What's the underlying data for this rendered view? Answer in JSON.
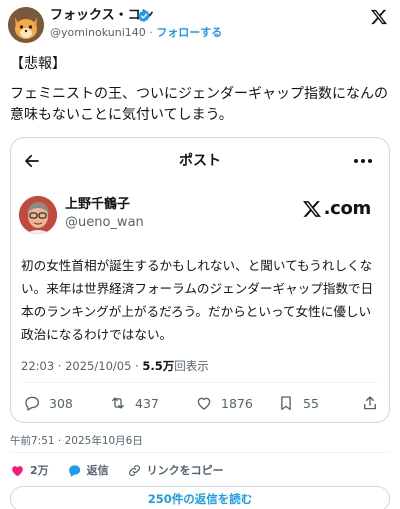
{
  "author": {
    "name": "フォックス・コン",
    "handle": "@yominokuni140",
    "follow_label": "フォローする"
  },
  "tweet": {
    "tag": "【悲報】",
    "text": "フェミニストの王、ついにジェンダーギャップ指数になんの意味もないことに気付いてしまう。",
    "timestamp": "午前7:51 · 2025年10月6日",
    "likes": "2万",
    "reply_label": "返信",
    "copy_link_label": "リンクをコピー",
    "read_replies_label": "250件の返信を読む"
  },
  "embed": {
    "header_title": "ポスト",
    "quoted": {
      "name": "上野千鶴子",
      "handle": "@ueno_wan",
      "site_logo_text": ".com",
      "text": "初の女性首相が誕生するかもしれない、と聞いてもうれしくない。来年は世界経済フォーラムのジェンダーギャップ指数で日本のランキングが上がるだろう。だからといって女性に優しい政治になるわけではない。",
      "time": "22:03 · 2025/10/05 · ",
      "views": "5.5万",
      "views_suffix": "回表示",
      "replies": "308",
      "reposts": "437",
      "likes": "1876",
      "bookmarks": "55"
    }
  },
  "colors": {
    "accent": "#1d9bf0",
    "like": "#f91880",
    "muted": "#536471"
  }
}
